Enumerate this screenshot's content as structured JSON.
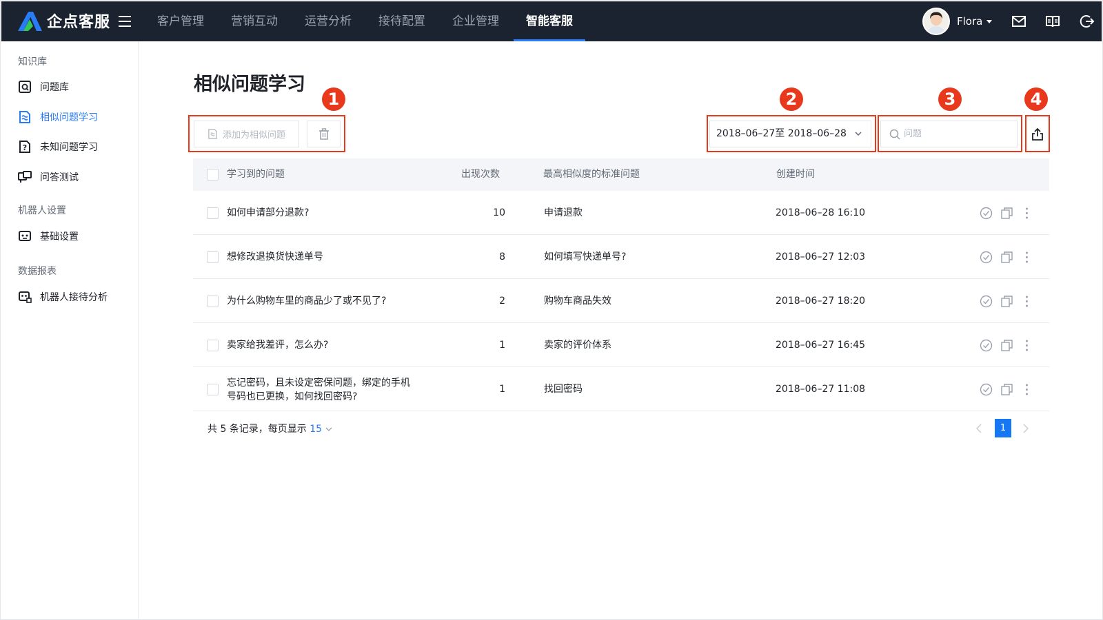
{
  "app": {
    "logo_text": "企点客服",
    "nav": [
      "客户管理",
      "营销互动",
      "运营分析",
      "接待配置",
      "企业管理",
      "智能客服"
    ],
    "active_nav": "智能客服",
    "user_name": "Flora"
  },
  "sidebar": {
    "groups": [
      {
        "title": "知识库",
        "items": [
          {
            "label": "问题库",
            "icon": "question-bank-icon"
          },
          {
            "label": "相似问题学习",
            "icon": "similar-learning-icon",
            "active": true
          },
          {
            "label": "未知问题学习",
            "icon": "unknown-question-icon"
          },
          {
            "label": "问答测试",
            "icon": "qa-test-icon"
          }
        ]
      },
      {
        "title": "机器人设置",
        "items": [
          {
            "label": "基础设置",
            "icon": "robot-icon"
          }
        ]
      },
      {
        "title": "数据报表",
        "items": [
          {
            "label": "机器人接待分析",
            "icon": "robot-analysis-icon"
          }
        ]
      }
    ]
  },
  "page": {
    "title": "相似问题学习",
    "add_button": "添加为相似问题",
    "date_range": "2018–06–27至 2018–06–28",
    "search_placeholder": "问题",
    "markers": [
      "1",
      "2",
      "3",
      "4"
    ]
  },
  "table": {
    "columns": [
      "学习到的问题",
      "出现次数",
      "最高相似度的标准问题",
      "创建时间"
    ],
    "rows": [
      {
        "question": "如何申请部分退款?",
        "count": "10",
        "standard": "申请退款",
        "created": "2018–06–28 16:10"
      },
      {
        "question": "想修改退换货快递单号",
        "count": "8",
        "standard": "如何填写快递单号?",
        "created": "2018–06–27 12:03"
      },
      {
        "question": "为什么购物车里的商品少了或不见了?",
        "count": "2",
        "standard": "购物车商品失效",
        "created": "2018–06–27 18:20"
      },
      {
        "question": "卖家给我差评，怎么办?",
        "count": "1",
        "standard": "卖家的评价体系",
        "created": "2018–06–27 16:45"
      },
      {
        "question_line1": "忘记密码，且未设定密保问题，绑定的手机",
        "question_line2": "号码也已更换，如何找回密码?",
        "count": "1",
        "standard": "找回密码",
        "created": "2018–06–27 11:08"
      }
    ]
  },
  "footer": {
    "summary_prefix": "共 5 条记录，每页显示",
    "page_size": "15",
    "current_page": "1"
  },
  "colors": {
    "nav_bg": "#1b2230",
    "accent": "#2a7cf6",
    "marker": "#e8391c"
  }
}
